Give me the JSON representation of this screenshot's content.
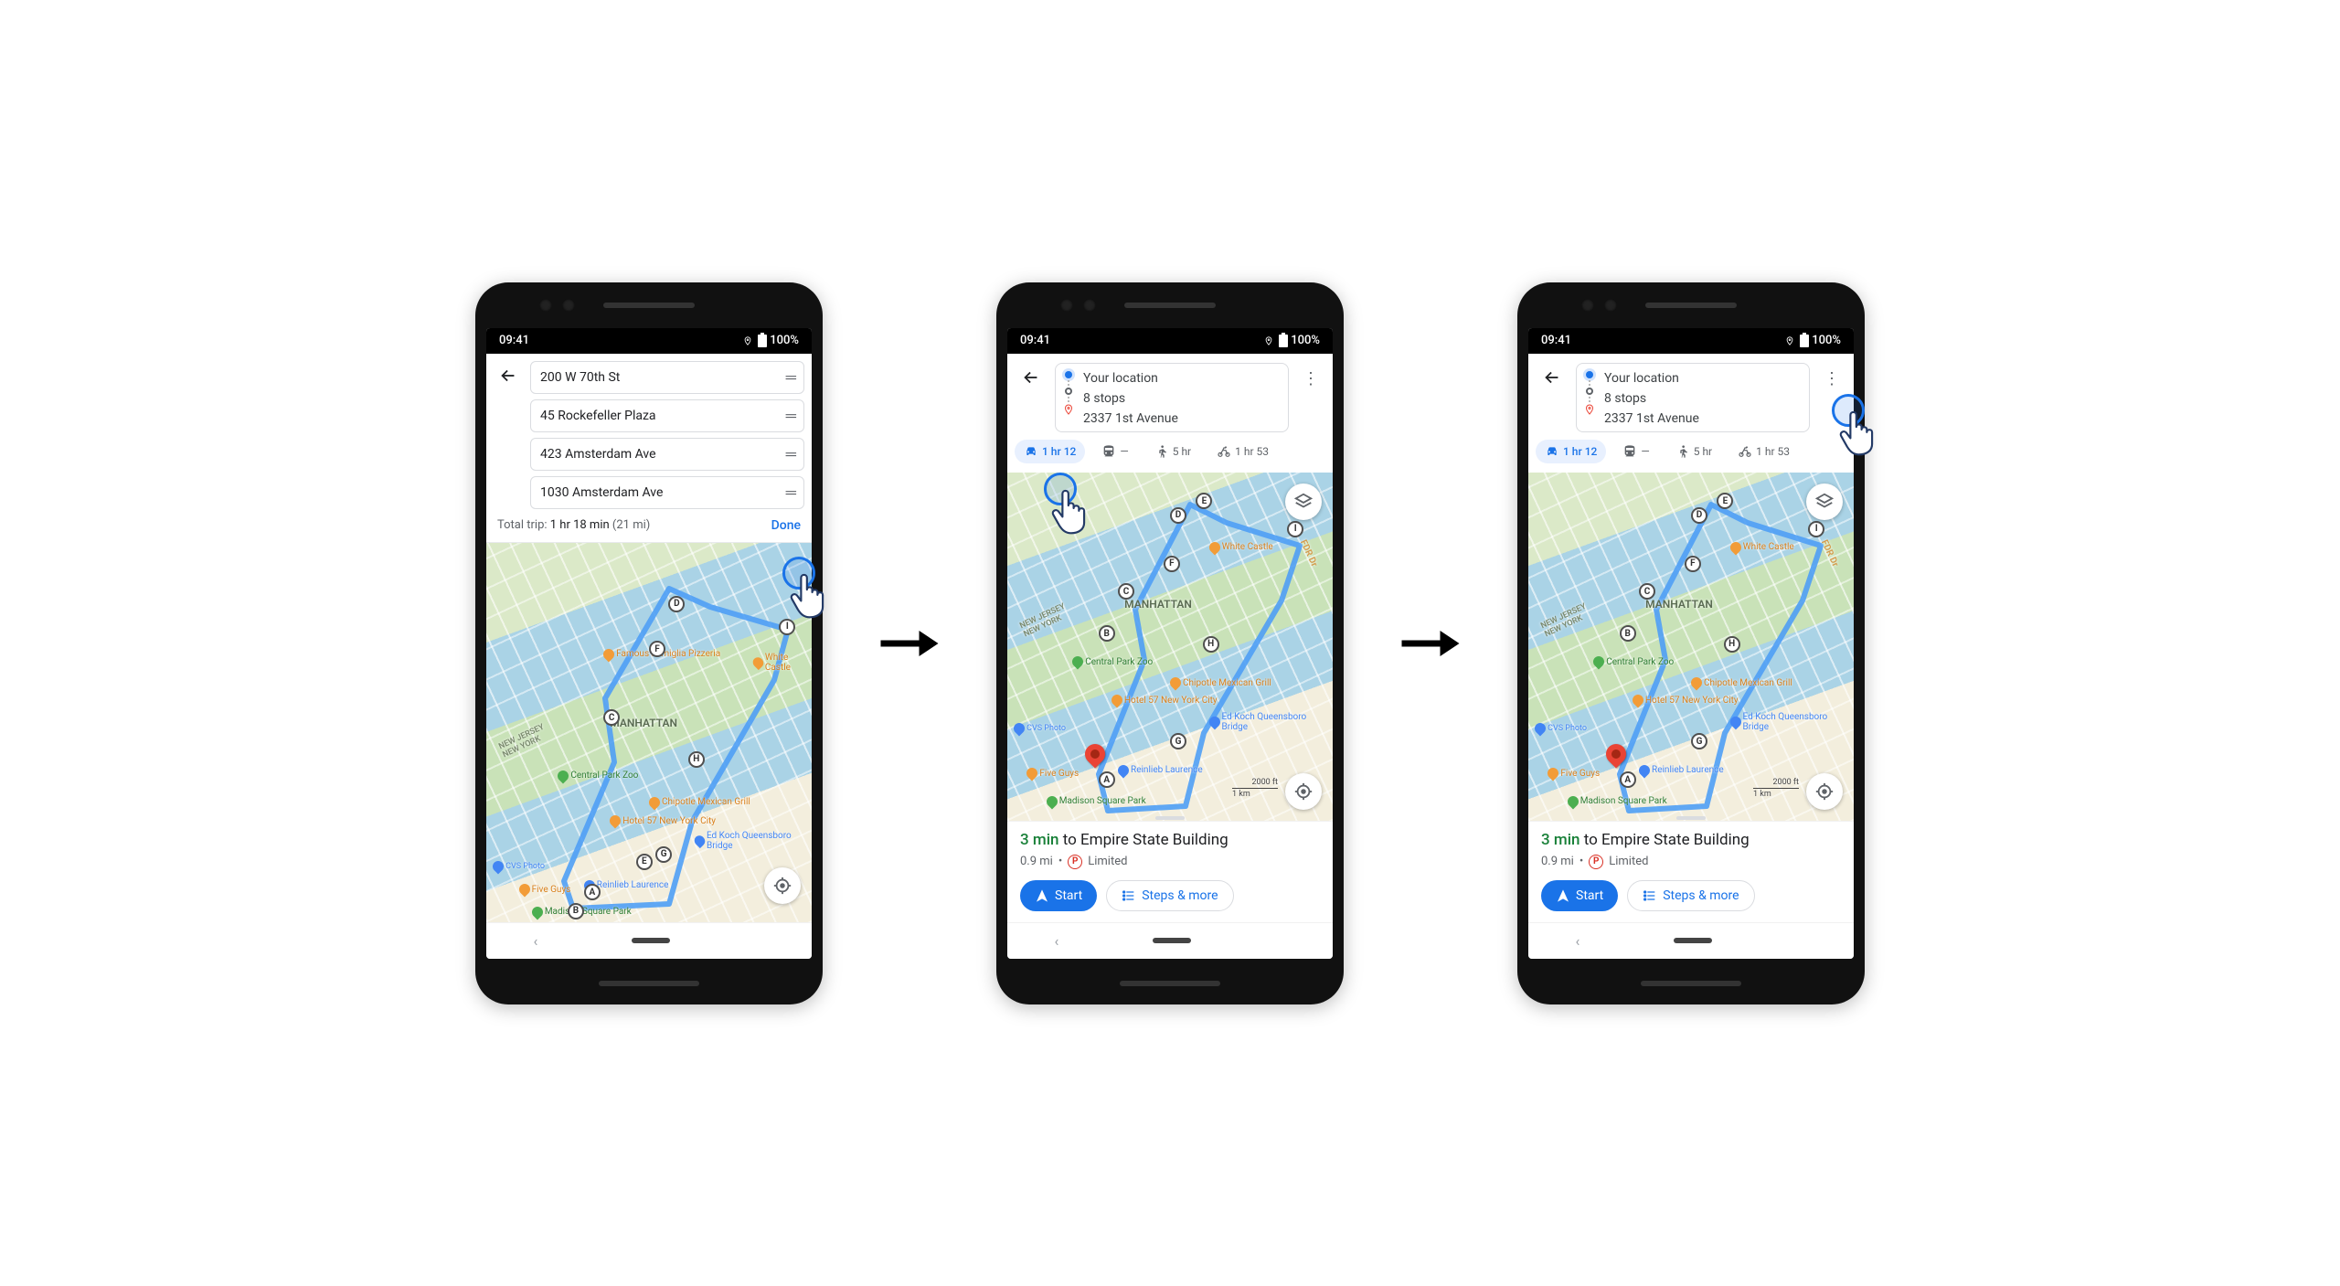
{
  "status": {
    "time": "09:41",
    "battery": "100%"
  },
  "screen1": {
    "stops": [
      {
        "name": "200 W 70th St"
      },
      {
        "name": "45 Rockefeller Plaza"
      },
      {
        "name": "423 Amsterdam Ave"
      },
      {
        "name": "1030 Amsterdam Ave"
      }
    ],
    "summary_label": "Total trip:",
    "summary_time": "1 hr 18 min",
    "summary_dist": "(21 mi)",
    "done": "Done"
  },
  "dir": {
    "origin": "Your location",
    "stops": "8 stops",
    "dest": "2337 1st Avenue"
  },
  "modes": {
    "drive": "1 hr 12",
    "transit": "—",
    "walk": "5 hr",
    "bike": "1 hr 53"
  },
  "map": {
    "manhattan": "MANHATTAN",
    "nj": "NEW JERSEY\nNEW YORK",
    "zoo": "Central Park Zoo",
    "hotel57": "Hotel 57 New York City",
    "chipotle": "Chipotle Mexican Grill",
    "whitecastle": "White Castle",
    "pizzeria": "Famous Famiglia Pizzeria",
    "koch": "Ed Koch Queensboro Bridge",
    "fiveguys": "Five Guys",
    "reinlieb": "Reinlieb Laurence",
    "mad_sq": "Madison Square Park",
    "cvs": "CVS Photo",
    "fdr": "FDR Dr",
    "scale_ft": "2000 ft",
    "scale_km": "1 km"
  },
  "sheet": {
    "eta_min": "3 min",
    "eta_to": " to Empire State Building",
    "dist": "0.9 mi",
    "parking": "Limited",
    "start": "Start",
    "steps": "Steps & more"
  }
}
